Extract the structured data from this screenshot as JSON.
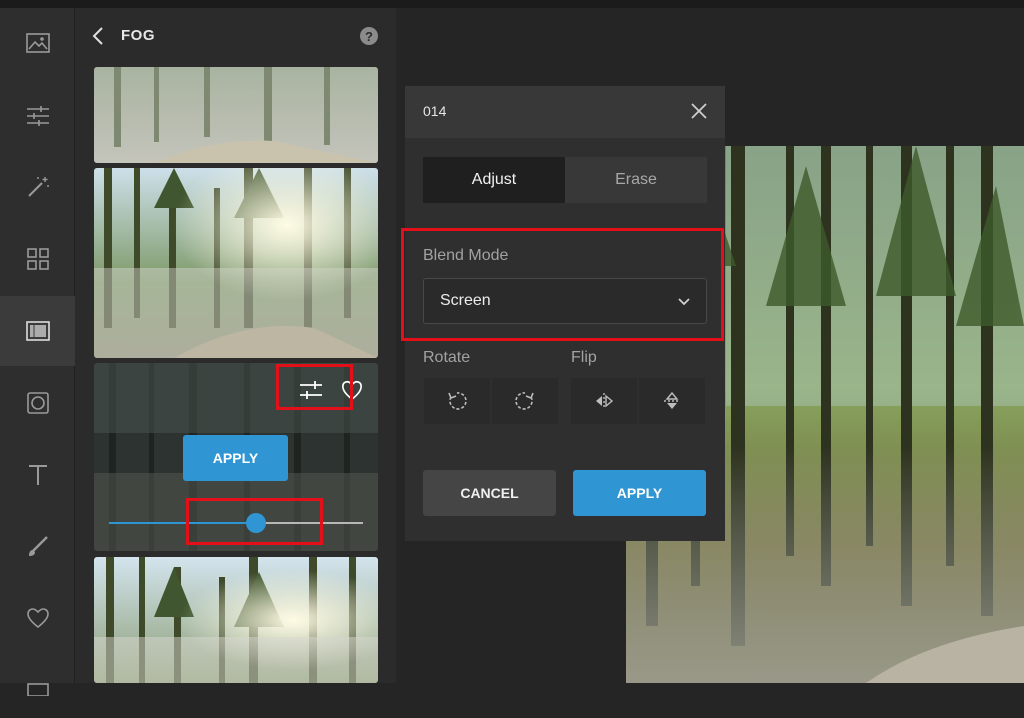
{
  "toolbar": {
    "tools": [
      "image-icon",
      "sliders-icon",
      "magic-wand-icon",
      "grid-icon",
      "overlays-icon",
      "frame-icon",
      "text-icon",
      "brush-icon",
      "heart-icon",
      "more-icon"
    ],
    "active_index": 4
  },
  "panel": {
    "title": "FOG",
    "help_label": "?",
    "active_thumb": {
      "apply_label": "APPLY",
      "slider_value": 0.58
    }
  },
  "dialog": {
    "title": "014",
    "tabs": {
      "adjust": "Adjust",
      "erase": "Erase"
    },
    "blend_mode_label": "Blend Mode",
    "blend_mode_value": "Screen",
    "rotate_label": "Rotate",
    "flip_label": "Flip",
    "cancel_label": "CANCEL",
    "apply_label": "APPLY"
  },
  "colors": {
    "accent": "#2f95d3",
    "highlight": "#e3101a"
  }
}
